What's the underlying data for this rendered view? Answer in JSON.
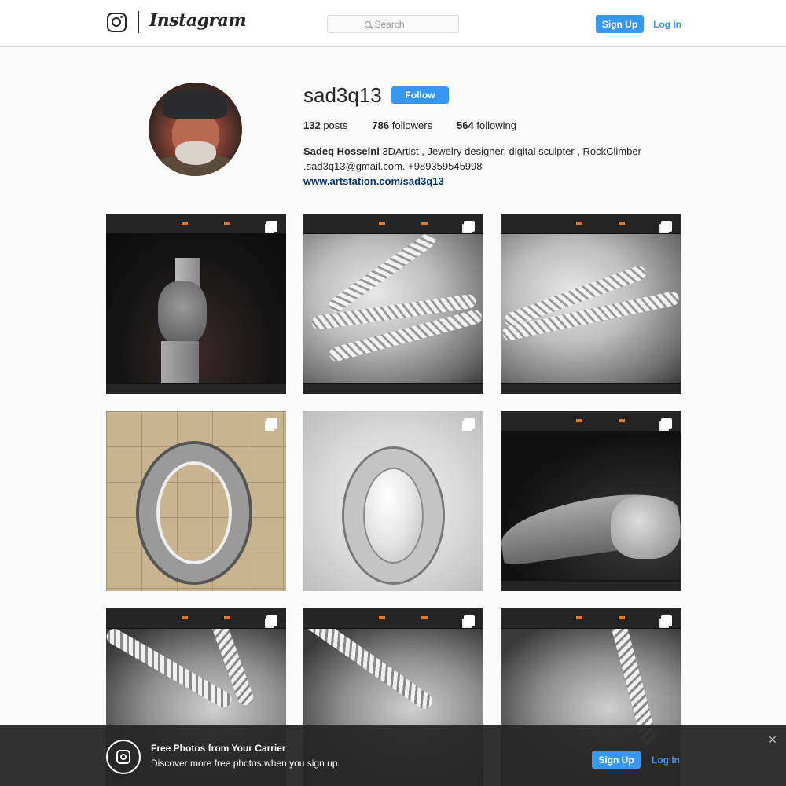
{
  "header": {
    "brand": "Instagram",
    "search_placeholder": "Search",
    "signup_label": "Sign Up",
    "login_label": "Log In"
  },
  "profile": {
    "username": "sad3q13",
    "follow_label": "Follow",
    "stats": {
      "posts_count": "132",
      "posts_label": "posts",
      "followers_count": "786",
      "followers_label": "followers",
      "following_count": "564",
      "following_label": "following"
    },
    "bio": {
      "full_name": "Sadeq Hosseini",
      "line1": " 3DArtist , Jewelry designer, digital sculpter , RockClimber",
      "line2": ".sad3q13@gmail.com. +989359545998",
      "link": "www.artstation.com/sad3q13"
    }
  },
  "banner": {
    "title": "Free Photos from Your Carrier",
    "subtitle": "Discover more free photos when you sign up.",
    "signup_label": "Sign Up",
    "login_label": "Log In",
    "close_glyph": "✕"
  },
  "colors": {
    "accent": "#3897f0",
    "link_dark": "#003569",
    "banner_bg": "#262626"
  },
  "icons": [
    "instagram-glyph-icon",
    "search-icon",
    "multiple-posts-icon",
    "close-icon"
  ]
}
